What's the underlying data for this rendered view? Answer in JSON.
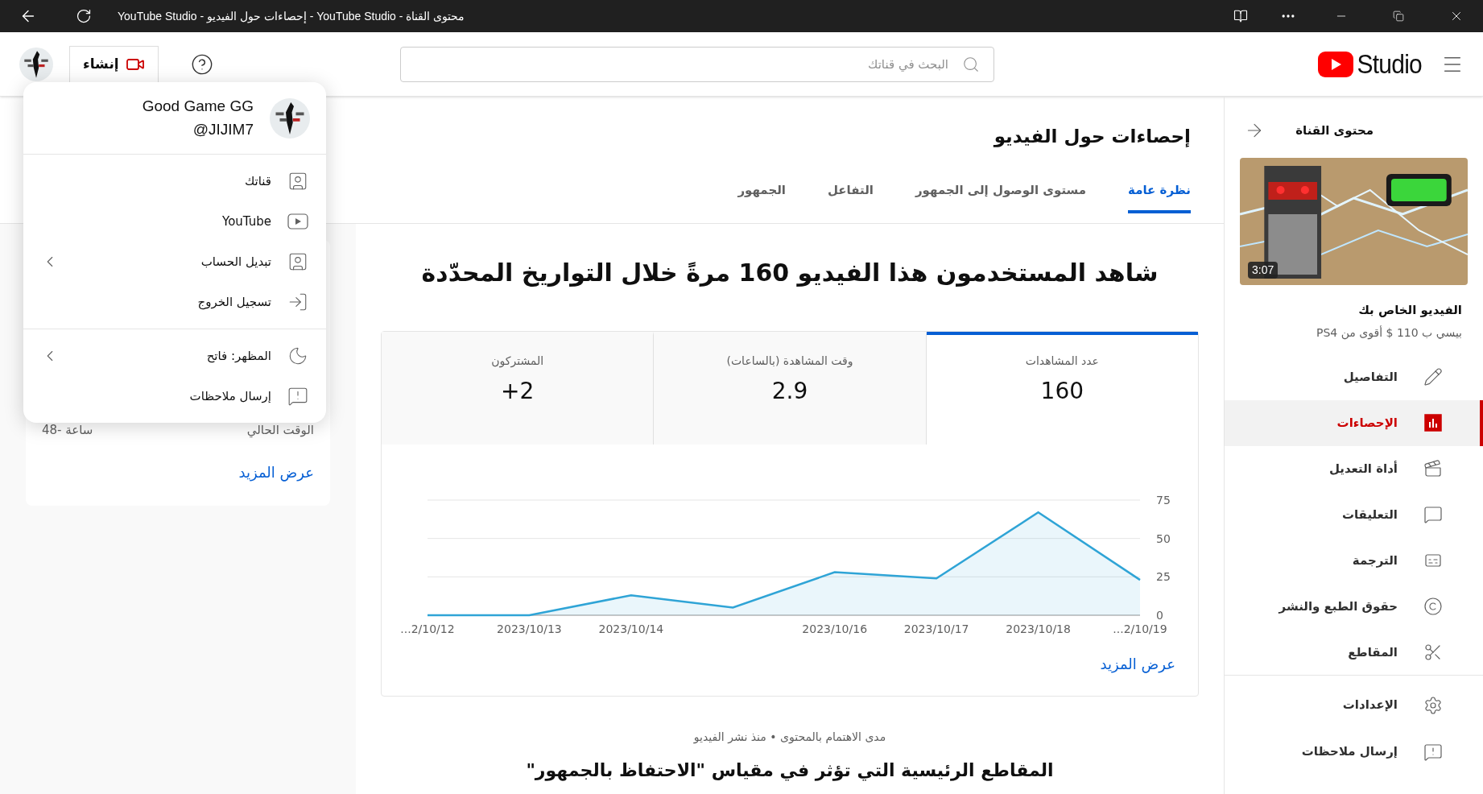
{
  "title_bar": {
    "title": "YouTube Studio - إحصاءات حول الفيديو - YouTube Studio - محتوى القناة"
  },
  "header": {
    "logo": "Studio",
    "search": {
      "placeholder": "البحث في قناتك"
    },
    "create_button": "إنشاء"
  },
  "account_menu": {
    "name": "Good Game GG",
    "handle": "@JIJIM7",
    "groups": [
      {
        "items": [
          {
            "label": "قناتك",
            "submenu": false
          },
          {
            "label": "YouTube",
            "submenu": false
          },
          {
            "label": "تبديل الحساب",
            "submenu": true
          },
          {
            "label": "تسجيل الخروج",
            "submenu": false
          }
        ]
      },
      {
        "items": [
          {
            "label": "المظهر: فاتح",
            "submenu": true
          },
          {
            "label": "إرسال ملاحظات",
            "submenu": false
          }
        ]
      }
    ]
  },
  "left_card": {
    "rows": [
      {
        "label": "الوقت الحالي",
        "value": "48- ساعة"
      }
    ],
    "link": "عرض المزيد"
  },
  "main": {
    "title": "إحصاءات حول الفيديو",
    "tabs": [
      {
        "label": "نظرة عامة",
        "selected": true
      },
      {
        "label": "مستوى الوصول إلى الجمهور",
        "selected": false
      },
      {
        "label": "التفاعل",
        "selected": false
      },
      {
        "label": "الجمهور",
        "selected": false
      }
    ],
    "headline": "شاهد المستخدمون هذا الفيديو **160** مرةً خلال التواريخ المحدّدة",
    "metrics": [
      {
        "label": "عدد المشاهدات",
        "value": "160",
        "selected": true
      },
      {
        "label": "وقت المشاهدة (بالساعات)",
        "value": "2.9",
        "selected": false
      },
      {
        "label": "المشتركون",
        "value": "+2",
        "selected": false
      }
    ],
    "chart_data": {
      "type": "area",
      "categories": [
        "...2/10/12",
        "2023/10/13",
        "2023/10/14",
        null,
        "2023/10/16",
        "2023/10/17",
        "2023/10/18",
        "...2/10/19"
      ],
      "series": [
        {
          "color": "#2fa4d6",
          "values": [
            0,
            0,
            13,
            5,
            28,
            24,
            67,
            23
          ]
        }
      ],
      "ylim": [
        0,
        75
      ],
      "yticks": [
        0,
        25,
        50,
        75
      ]
    },
    "more_link": "عرض المزيد",
    "section_subtitle": "مدى الاهتمام بالمحتوى • منذ نشر الفيديو",
    "section_heading": "المقاطع الرئيسية التي تؤثر في مقياس \"الاحتفاظ بالجمهور\""
  },
  "sidebar": {
    "back_label": "محتوى القناة",
    "video": {
      "duration": "3:07",
      "caption": "الفيديو الخاص بك",
      "title": "بيسي ب 110 $ أقوى من PS4"
    },
    "nav": [
      {
        "label": "التفاصيل",
        "selected": false
      },
      {
        "label": "الإحصاءات",
        "selected": true
      },
      {
        "label": "أداة التعديل",
        "selected": false
      },
      {
        "label": "التعليقات",
        "selected": false
      },
      {
        "label": "الترجمة",
        "selected": false
      },
      {
        "label": "حقوق الطبع والنشر",
        "selected": false
      },
      {
        "label": "المقاطع",
        "selected": false
      }
    ],
    "footer": [
      {
        "label": "الإعدادات"
      },
      {
        "label": "إرسال ملاحظات"
      }
    ]
  }
}
